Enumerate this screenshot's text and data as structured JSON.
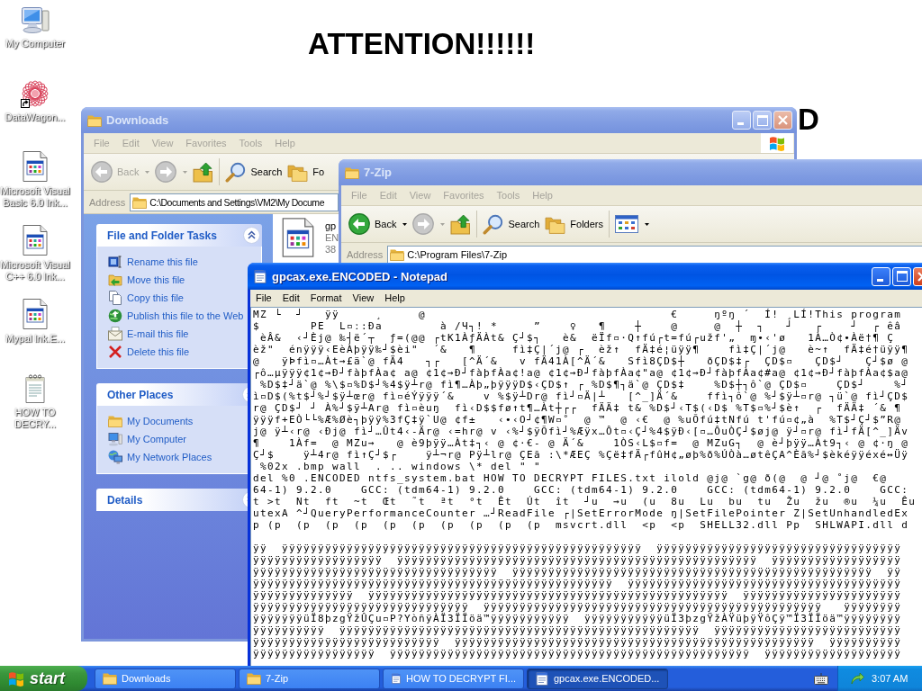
{
  "wallpaper": {
    "heading": "ATTENTION!!!!!!",
    "fragment": "D"
  },
  "desktop_icons": [
    {
      "kind": "computer",
      "label": "My Computer",
      "shortcut": false
    },
    {
      "kind": "flower",
      "label": "DataWagon...",
      "shortcut": true
    },
    {
      "kind": "program",
      "label": "Microsoft Visual\nBasic 6.0 lnk...",
      "shortcut": false
    },
    {
      "kind": "program",
      "label": "Microsoft Visual\nC++ 6.0 lnk...",
      "shortcut": false
    },
    {
      "kind": "program",
      "label": "Mypal lnk.E...",
      "shortcut": false
    },
    {
      "kind": "textfile",
      "label": "HOW TO\nDECRY...",
      "shortcut": false
    }
  ],
  "explorer_windows": [
    {
      "title": "Downloads",
      "active": false,
      "controls": [
        {
          "kind": "minimize"
        },
        {
          "kind": "maximize"
        },
        {
          "kind": "close"
        }
      ],
      "menu": [
        "File",
        "Edit",
        "View",
        "Favorites",
        "Tools",
        "Help"
      ],
      "logo": true,
      "toolbar": [
        {
          "kind": "back",
          "label": "Back",
          "disabled": true,
          "dropdown": true
        },
        {
          "kind": "forward",
          "disabled": true,
          "dropdown": true
        },
        {
          "kind": "up",
          "disabled": false,
          "dropdown": false
        },
        {
          "kind": "search",
          "label": "Search",
          "disabled": false,
          "dropdown": false
        },
        {
          "kind": "folders",
          "label": "Fo",
          "disabled": false,
          "dropdown": false
        }
      ],
      "address_label": "Address",
      "address": "C:\\Documents and Settings\\VM2\\My Docume",
      "task_panels": [
        {
          "title": "File and Folder Tasks",
          "expanded": true,
          "items": [
            {
              "kind": "rename",
              "label": "Rename this file"
            },
            {
              "kind": "move",
              "label": "Move this file"
            },
            {
              "kind": "copy",
              "label": "Copy this file"
            },
            {
              "kind": "publish",
              "label": "Publish this file to the Web"
            },
            {
              "kind": "email",
              "label": "E-mail this file"
            },
            {
              "kind": "delete",
              "label": "Delete this file"
            }
          ]
        },
        {
          "title": "Other Places",
          "expanded": true,
          "items": [
            {
              "kind": "documents",
              "label": "My Documents"
            },
            {
              "kind": "computer",
              "label": "My Computer"
            },
            {
              "kind": "network",
              "label": "My Network Places"
            }
          ]
        },
        {
          "title": "Details",
          "expanded": false
        }
      ],
      "files": [
        {
          "kind": "program",
          "name": "gp",
          "type": "EN",
          "size": "38"
        }
      ]
    },
    {
      "title": "7-Zip",
      "active": false,
      "menu": [
        "File",
        "Edit",
        "View",
        "Favorites",
        "Tools",
        "Help"
      ],
      "toolbar": [
        {
          "kind": "back",
          "label": "Back",
          "disabled": false,
          "dropdown": true
        },
        {
          "kind": "forward",
          "disabled": true,
          "dropdown": true
        },
        {
          "kind": "up",
          "disabled": false,
          "dropdown": false
        },
        {
          "kind": "search",
          "label": "Search",
          "disabled": false,
          "dropdown": false
        },
        {
          "kind": "folders",
          "label": "Folders",
          "disabled": false,
          "dropdown": false
        },
        {
          "kind": "views",
          "disabled": false,
          "dropdown": true
        }
      ],
      "address_label": "Address",
      "address": "C:\\Program Files\\7-Zip"
    }
  ],
  "notepad": {
    "title": "gpcax.exe.ENCODED - Notepad",
    "active": true,
    "controls": [
      {
        "kind": "minimize"
      },
      {
        "kind": "maximize"
      },
      {
        "kind": "close"
      }
    ],
    "menu": [
      "File",
      "Edit",
      "Format",
      "View",
      "Help"
    ],
    "text": "MZ └  ┘   ÿÿ     ¸     @                                  €     ŋºŋ ´  Í! ¸LÍ!This program\n$       PE  L▫ː:Ða        à /Ч┐! *     ”    ♀   ¶    ┼    @     @  ┼  ┐   ┘   ┌    ┘  ┌ êâ\n èÂ&  ‹┘Èj@ ‰┤ë´┬  ƒ=(@@ ┌tK1ÀƒÄÀt& Ç┘$┐   è&  ëÏf▫·Q↑fú┌t=fú┌užf'„  ɱ•‹'ø   1À…Ò¢•Àë†¶ Ç\nèž\"  énÿÿÿ‹EèÀþÿÿ‰┘$èi\"  ´&   ¶     fì‡Ç|´j@ ┌  èž↑  fÄ‡é¦üÿÿ¶    fì‡Ç|´j@   è~↑  fÄ‡é†üÿÿ¶\n@   ÿÞfì▫…Àt→£ä`@ fÄ4   ┐┌   [^Ä´&   v fÄ41À[^Ä´&   Sfì8ÇD$┼   ðÇD$‡┌  ÇD$▫   ÇD$┘   Ç┘$ø @\n┌ô…µÿÿÿ¢1¢→Ð┘fàþfÀa¢ a@ ¢1¢→Ð┘fàþfÀa¢!a@ ¢1¢→Ð┘fàþfÀa¢\"a@ ¢1¢→Ð┘fàþfÀa¢#a@ ¢1¢→Ð┘fàþfÀa¢$a@\n %D$‡┘ä`@ %\\$▫%D$┘%4$ÿ┴r@ fì¶…Àþ„þÿÿÿD$‹ÇD$↑ ┌ %D$¶┐ä`@ ÇD$‡    %D$┼┐ô`@ ÇD$▫    ÇD$┘    %┘\nì▫D$(%t$┘%┘$ÿ┴œr@ fì▫éÝÿÿÿ´&    v %$ÿ┴Dr@ fì┘▫Ä|┴   [^_]Ä´&    ffì┐ô`@ %┘$ÿ┴▫r@ ┐ü`@ fì┘ÇD$\nr@ ÇD$┘ ┘ À%┘$ÿ┴Ar@ fì▫èuŋ  fì‹D$$fø↑t¶…Àt┼┌┌  fÄÄ‡ t& %D$┘‹T$(‹D$ %T$▫%┘$è↑  ┌  fÄÄ‡ ´& ¶\nÿÿÿf+EÒ└└%Æ%Øè┐þÿÿ%3fÇ‡ÿ`U@ ¢f±   ‹•‹O┘¢¶W▫˚  @ ™  @ ‹€  @ %uÕfú‡tNfú t'fú▫¢„à  %T$┘Ç┘$”R@\nj@ ÿ┴‹r@ ‹Ðj@ fì┘…Ût4‹-Är@ ‹=hr@ v ‹%┘$ÿÕfì┘%Æÿx…Ôt▫‹Ç┘%4$ÿÐ‹[▫…ÔuÒÇ┘$øj@ ÿ┘▫r@ fì┘fÄ[^_]Äv\n¶    1Àf=  @ MZu→   @ è9þÿÿ…Àt‡┐‹ @ ¢·€- @ Ä´&    1ÒS‹L$▫f=  @ MZuG┐  @ è┘þÿÿ…Àt9┐‹ @ ¢·ŋ @\nÇ┘$    ÿ┴4r@ fì↑Ç┘$┌    ÿ┴¬r@ Pÿ┴lr@ ÇEã :\\*ÆEÇ %Çë‡fÄ┌fûH¢„øþ%ð%ÚÒà…øtêÇA^Èã%┘$èkéÿÿéxé↔Üÿ\n %02x .bmp wall  . .. windows \\* del \" \"\ndel %0 .ENCODED ntfs_system.bat HOW TO DECRYPT FILES.txt ilold @j@ `g@ ð(@  @ ┘@ ˚j@  €@\n64-1) 9.2.0    GCC: (tdm64-1) 9.2.0    GCC: (tdm64-1) 9.2.0    GCC: (tdm64-1) 9.2.0    GCC:\nt >t  Nt  ft  ~t  Œt  ˜t  ªt  °t  Êt  Út  ît  ┘u  →u  (u  8u  Lu  bu  tu  Žu  žu  ®u  ¼u  Êu\nutexA ^┘QueryPerformanceCounter …┘ReadFile ┌|SetErrorMode ŋ|SetFilePointer Z|SetUnhandledEx\np (p  (p  (p  (p  (p  (p  (p  (p  (p  (p  msvcrt.dll  <p  <p  SHELL32.dll Pp  SHLWAPI.dll d\n\nÿÿ  ÿÿÿÿÿÿÿÿÿÿÿÿÿÿÿÿÿÿÿÿÿÿÿÿÿÿÿÿÿÿÿÿÿÿÿÿÿÿÿÿÿÿÿÿÿÿÿÿÿÿ  ÿÿÿÿÿÿÿÿÿÿÿÿÿÿÿÿÿÿÿÿÿÿÿÿÿÿÿÿÿÿÿÿÿÿ\nÿÿÿÿÿÿÿÿÿÿÿÿÿÿÿÿÿÿ  ÿÿÿÿÿÿÿÿÿÿÿÿÿÿÿÿÿÿÿÿÿÿÿÿÿÿÿÿÿÿÿÿÿÿÿÿÿÿÿÿÿÿÿÿÿÿÿÿÿÿ  ÿÿÿÿÿÿÿÿÿÿÿÿÿÿÿÿÿÿ\nÿÿÿÿÿÿÿÿÿÿÿÿÿÿÿÿÿÿÿÿÿÿÿÿÿÿÿÿÿÿÿÿÿÿ  ÿÿÿÿÿÿÿÿÿÿÿÿÿÿÿÿÿÿÿÿÿÿÿÿÿÿÿÿÿÿÿÿÿÿÿÿÿÿÿÿÿÿÿÿÿÿÿÿÿÿ  ÿÿ\nÿÿÿÿÿÿÿÿÿÿÿÿÿÿÿÿÿÿÿÿÿÿÿÿÿÿÿÿÿÿÿÿÿÿÿÿÿÿÿÿÿÿÿÿÿÿÿÿÿÿ  ÿÿÿÿÿÿÿÿÿÿÿÿÿÿÿÿÿÿÿÿÿÿÿÿÿÿÿÿÿÿÿÿÿÿÿÿÿÿ\nÿÿÿÿÿÿÿÿÿÿÿÿÿÿ  ÿÿÿÿÿÿÿÿÿÿÿÿÿÿÿÿÿÿÿÿÿÿÿÿÿÿÿÿÿÿÿÿÿÿÿÿÿÿÿÿÿÿÿÿÿÿÿÿÿÿ  ÿÿÿÿÿÿÿÿÿÿÿÿÿÿÿÿÿÿÿÿÿÿ\nÿÿÿÿÿÿÿÿÿÿÿÿÿÿÿÿÿÿÿÿÿÿÿÿÿÿÿÿÿÿ  ÿÿÿÿÿÿÿÿÿÿÿÿÿÿÿÿÿÿÿÿÿÿÿÿÿÿÿÿÿÿÿÿÿÿÿÿÿÿÿÿÿÿÿÿÿÿÿ   ÿÿÿÿÿÿÿÿ\nÿÿÿÿÿÿÿüÏ8þzgŸžÛÇu▫P?YòñÿÀÏ3ÏÏöä™ÿÿÿÿÿÿÿÿÿÿÿ  ÿÿÿÿÿÿÿÿÿÿÿüÏ3þzgŸžÀŸüþÿŸôÇÿ™Ï3ÏÏöä™ÿÿÿÿÿÿÿÿ\nÿÿÿÿÿÿÿÿÿÿ  ÿÿÿÿÿÿÿÿÿÿÿÿÿÿÿÿÿÿÿÿÿÿÿÿÿÿÿÿÿÿÿÿÿÿÿÿÿÿÿÿÿÿÿÿÿÿÿÿÿÿ  ÿÿÿÿÿÿÿÿÿÿÿÿÿÿÿÿÿÿÿÿÿÿÿÿÿÿ\nÿÿÿÿÿÿÿÿÿÿÿÿÿÿÿÿÿÿÿÿÿÿÿÿÿÿ  ÿÿÿÿÿÿÿÿÿÿÿÿÿÿÿÿÿÿÿÿÿÿÿÿÿÿÿÿÿÿÿÿÿÿÿÿÿÿÿÿÿÿÿÿÿÿÿÿÿÿ  ÿÿÿÿÿÿÿÿÿÿ\nÿÿÿÿÿÿÿÿÿÿÿÿÿÿÿÿÿ  ÿÿÿÿÿÿÿÿÿÿÿÿÿÿÿÿÿÿÿÿÿÿÿÿÿÿÿÿÿÿÿÿÿÿÿÿÿÿÿÿÿÿÿÿÿÿÿÿÿÿ  ÿÿÿÿÿÿÿÿÿÿÿÿÿÿÿÿÿÿÿ"
  },
  "taskbar": {
    "start": "start",
    "tasks": [
      {
        "kind": "folder",
        "label": "Downloads",
        "selected": false
      },
      {
        "kind": "folder",
        "label": "7-Zip",
        "selected": false
      },
      {
        "kind": "notepad",
        "label": "HOW TO DECRYPT FI...",
        "selected": false
      },
      {
        "kind": "notepad",
        "label": "gpcax.exe.ENCODED...",
        "selected": true
      }
    ],
    "clock": "3:07 AM"
  }
}
